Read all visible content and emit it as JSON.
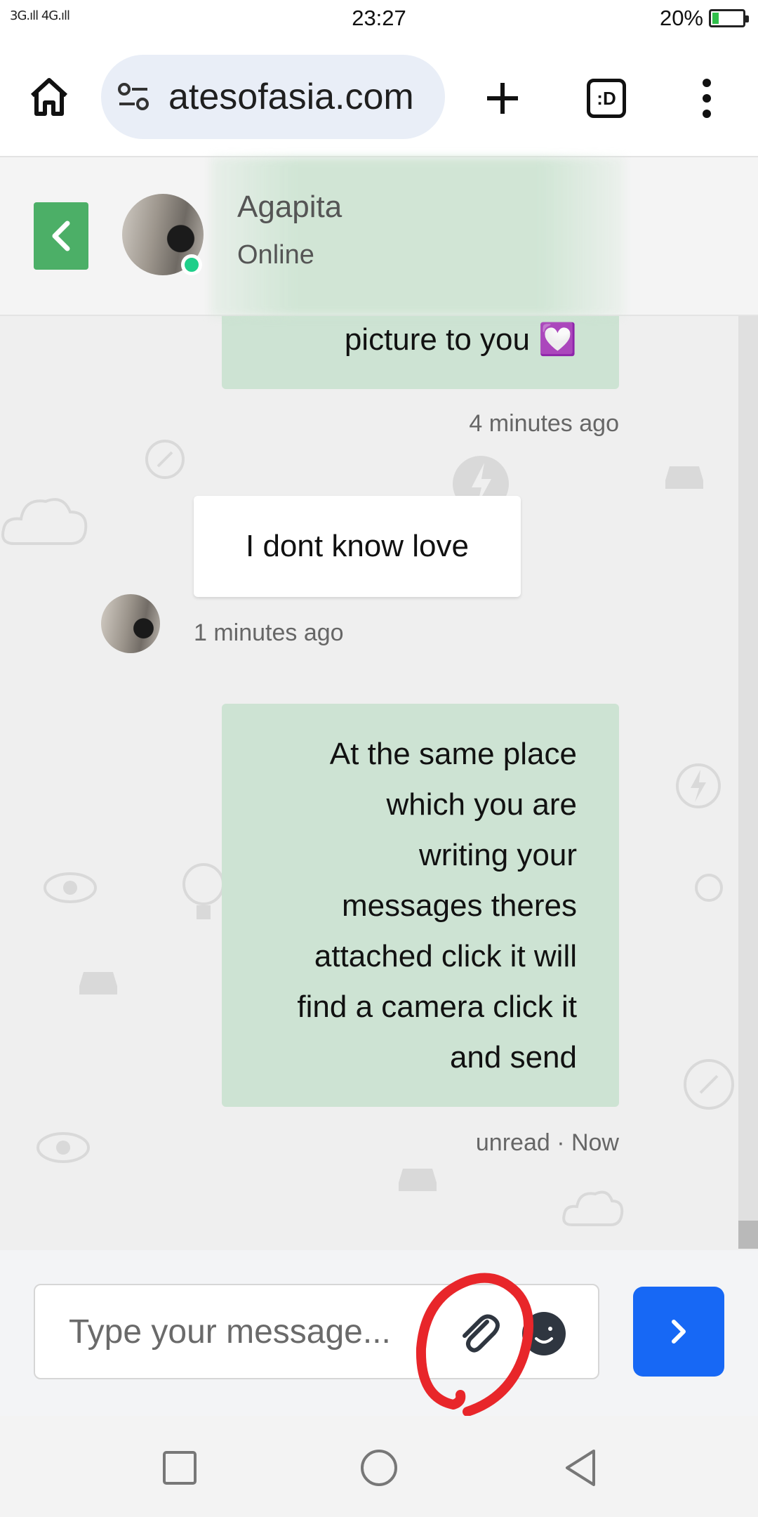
{
  "status_bar": {
    "signal": "3G.ıll 4G.ıll",
    "time": "23:27",
    "battery": "20%",
    "battery_level": 0.2
  },
  "browser": {
    "url": "atesofasia.com",
    "tabs_label": ":D"
  },
  "chat_header": {
    "name": "Agapita",
    "status": "Online"
  },
  "messages": {
    "m1": {
      "text": "picture to you 💟",
      "time": "4 minutes ago"
    },
    "m2": {
      "text": "I dont know love",
      "time": "1 minutes ago"
    },
    "m3": {
      "text": "At the same place which you are writing your messages theres attached click it will find a camera click it and send",
      "lines": [
        "At the same place",
        "which you are",
        "writing your",
        "messages theres",
        "attached click it will",
        "find a camera click it",
        "and send"
      ],
      "status": "unread · Now"
    }
  },
  "composer": {
    "placeholder": "Type your message..."
  },
  "colors": {
    "outgoing_bubble": "#cde3d3",
    "incoming_bubble": "#ffffff",
    "send_button": "#1768f5",
    "back_button": "#4caf67",
    "online": "#1fcf8a",
    "annotation": "#e8262a"
  },
  "icons": {
    "home": "home-icon",
    "site_settings": "tune-icon",
    "new_tab": "plus-icon",
    "menu": "more-vert-icon",
    "back": "chevron-left-icon",
    "attach": "paperclip-icon",
    "emoji": "emoji-icon",
    "send": "chevron-right-icon"
  }
}
